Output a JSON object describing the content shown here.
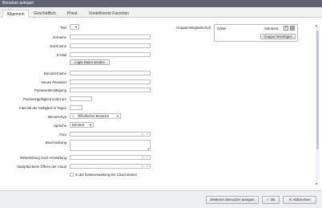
{
  "window": {
    "title": "Benutzer anlegen"
  },
  "tabs": [
    "Allgemein",
    "Geschäftlich",
    "Privat",
    "Vordefinierte Favoriten"
  ],
  "form": {
    "titel": {
      "label": "Titel",
      "value": ""
    },
    "vorname": {
      "label": "Vorname",
      "value": ""
    },
    "nachname": {
      "label": "Nachname",
      "value": ""
    },
    "email": {
      "label": "E-Mail",
      "value": ""
    },
    "login_button": "Login-Daten senden",
    "benutzername": {
      "label": "Benutzername",
      "value": ""
    },
    "passwort": {
      "label": "Neues Passwort",
      "value": ""
    },
    "passwort_bestaetigung": {
      "label": "Passwortbestätigung",
      "value": ""
    },
    "passwort_gueltig": {
      "label": "Passwortgültigkeit endet am",
      "value": ""
    },
    "intervall": {
      "label": "Intervall der Gültigkeit in Tagen",
      "value": ""
    },
    "benutzertyp": {
      "label": "Benutzertyp",
      "value": "Öffentlicher Benutzer"
    },
    "sprache": {
      "label": "Sprache",
      "value": "Deutsch"
    },
    "foto": {
      "label": "Foto",
      "value": ""
    },
    "beschreibung": {
      "label": "Beschreibung",
      "value": ""
    },
    "weiterleitung": {
      "label": "Weiterleitung nach Anmeldung",
      "value": ""
    },
    "startpfad": {
      "label": "Startpfad beim Öffnen der Cloud",
      "value": ""
    },
    "checkbox_label": "In der Dateiverwaltung der Cloud starten"
  },
  "gruppen": {
    "label": "Gruppenmitgliedschaft",
    "entry_name": "Gäste",
    "entry_status": "Standard",
    "add_button": "Gruppe hinzufügen"
  },
  "footer": {
    "another": "Weiteren Benutzer anlegen",
    "ok": "Ok",
    "cancel": "Abbrechen"
  },
  "colors": {
    "titlebar": "#5b6470",
    "ok_check": "#2e8b2e",
    "cancel_x": "#c0392b"
  }
}
